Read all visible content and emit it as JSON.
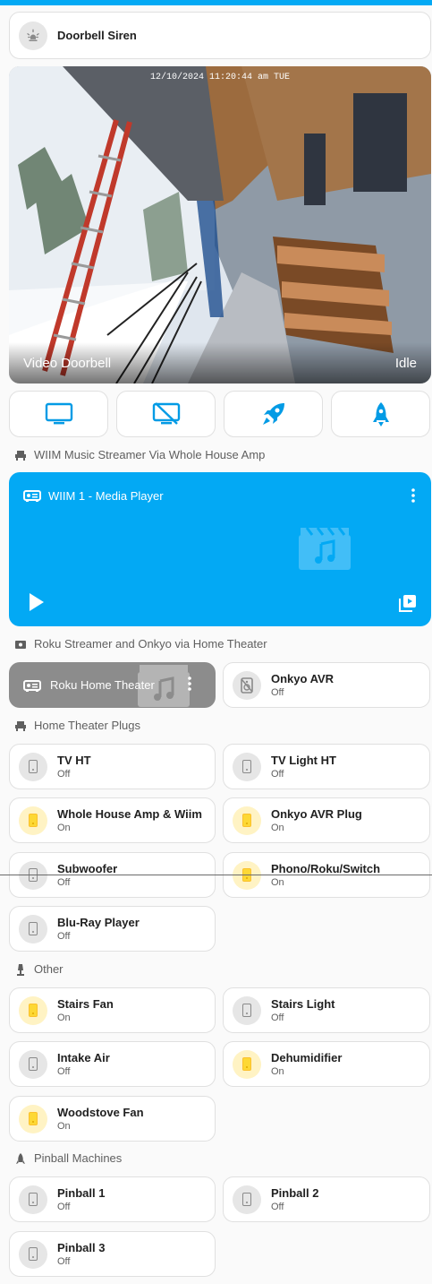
{
  "colors": {
    "accent": "#03a9f4",
    "on_state": "#fdd835",
    "card_bg": "#ffffff",
    "page_bg": "#fafafa"
  },
  "doorbell_siren": {
    "label": "Doorbell Siren",
    "icon": "siren-icon"
  },
  "camera": {
    "timestamp": "12/10/2024 11:20:44 am TUE",
    "name": "Video Doorbell",
    "state": "Idle"
  },
  "action_buttons": [
    {
      "icon": "tv-icon"
    },
    {
      "icon": "tv-off-icon"
    },
    {
      "icon": "rocket-launch-icon"
    },
    {
      "icon": "rocket-icon"
    }
  ],
  "sections": {
    "wiim": "WIIM Music Streamer Via Whole House Amp",
    "roku": "Roku Streamer and Onkyo via Home Theater",
    "plugs": "Home Theater Plugs",
    "other": "Other",
    "pinball": "Pinball Machines"
  },
  "wiim_player": {
    "title": "WIIM 1 - Media Player",
    "icon": "speaker-icon"
  },
  "roku_player": {
    "title": "Roku Home Theater",
    "icon": "speaker-icon"
  },
  "onkyo": {
    "name": "Onkyo AVR",
    "state": "Off"
  },
  "plugs": [
    {
      "name": "TV HT",
      "state": "Off"
    },
    {
      "name": "TV Light HT",
      "state": "Off"
    },
    {
      "name": "Whole House Amp & Wiim",
      "state": "On"
    },
    {
      "name": "Onkyo AVR Plug",
      "state": "On"
    },
    {
      "name": "Subwoofer",
      "state": "Off"
    },
    {
      "name": "Phono/Roku/Switch",
      "state": "On"
    },
    {
      "name": "Blu-Ray Player",
      "state": "Off"
    }
  ],
  "other": [
    {
      "name": "Stairs Fan",
      "state": "On"
    },
    {
      "name": "Stairs Light",
      "state": "Off"
    },
    {
      "name": "Intake Air",
      "state": "Off"
    },
    {
      "name": "Dehumidifier",
      "state": "On"
    },
    {
      "name": "Woodstove Fan",
      "state": "On"
    }
  ],
  "pinball": [
    {
      "name": "Pinball 1",
      "state": "Off"
    },
    {
      "name": "Pinball 2",
      "state": "Off"
    },
    {
      "name": "Pinball 3",
      "state": "Off"
    }
  ]
}
